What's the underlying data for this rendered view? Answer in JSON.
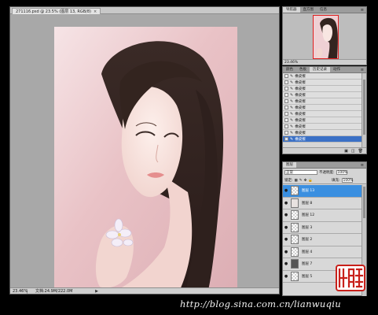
{
  "document": {
    "tab_title": "271116.psd @ 23.5% (图层 13, RGB/8)",
    "zoom": "23.46%",
    "file_info": "文档:24.9M/222.0M"
  },
  "navigator": {
    "tabs": [
      "导航器",
      "直方图",
      "信息"
    ],
    "zoom": "23.46%"
  },
  "history": {
    "tabs": [
      "颜色",
      "色板",
      "历史记录",
      "动作"
    ],
    "items": [
      "橡皮擦",
      "橡皮擦",
      "橡皮擦",
      "橡皮擦",
      "橡皮擦",
      "橡皮擦",
      "橡皮擦",
      "橡皮擦",
      "橡皮擦",
      "橡皮擦",
      "橡皮擦"
    ]
  },
  "layers": {
    "tabs": [
      "图层"
    ],
    "blend_mode": "正常",
    "opacity_label": "不透明度:",
    "opacity": "100%",
    "lock_label": "锁定:",
    "fill_label": "填充:",
    "fill": "100%",
    "items": [
      {
        "name": "图层 13",
        "selected": true,
        "thumb": "transparent"
      },
      {
        "name": "图层 8",
        "selected": false,
        "thumb": "sketch"
      },
      {
        "name": "图层 12",
        "selected": false,
        "thumb": "transparent"
      },
      {
        "name": "图层 3",
        "selected": false,
        "thumb": "transparent"
      },
      {
        "name": "图层 2",
        "selected": false,
        "thumb": "transparent"
      },
      {
        "name": "图层 4",
        "selected": false,
        "thumb": "transparent"
      },
      {
        "name": "图层 7",
        "selected": false,
        "thumb": "dark"
      },
      {
        "name": "图层 5",
        "selected": false,
        "thumb": "transparent"
      }
    ]
  },
  "seal": {
    "text": "小情歌"
  },
  "watermark": "http://blog.sina.com.cn/lianwuqiu",
  "colors": {
    "selection": "#3a70c6",
    "layer_selection": "#3a8fe0",
    "navigator_box": "#e02020",
    "seal": "#c8201a"
  }
}
